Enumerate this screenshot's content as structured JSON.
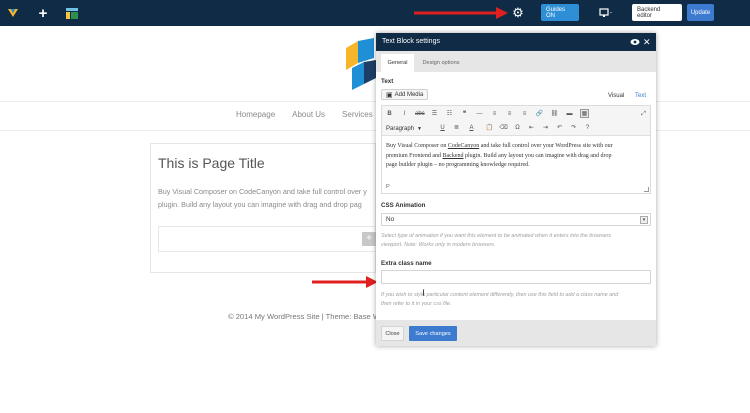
{
  "topbar": {
    "logo_icon": "composer-logo-icon",
    "add_icon": "plus-icon",
    "layout_icon": "layout-icon",
    "settings_icon": "gear-icon",
    "guides_label": "Guides ON",
    "device_icon": "monitor-icon",
    "backend_label": "Backend editor",
    "update_label": "Update"
  },
  "site": {
    "nav": [
      "Homepage",
      "About Us",
      "Services"
    ],
    "page_title": "This is Page Title",
    "page_text_lines": [
      "Buy Visual Composer on CodeCanyon and take full control over y",
      "plugin. Build any layout you can imagine with drag and drop pag"
    ],
    "add_icon": "plus-icon",
    "footer": "© 2014 My WordPress Site | Theme: Base W"
  },
  "panel": {
    "title": "Text Block settings",
    "visibility_icon": "eye-icon",
    "close_icon": "close-icon",
    "tabs": [
      "General",
      "Design options"
    ],
    "text_label": "Text",
    "add_media": "Add Media",
    "visual_tab": "Visual",
    "text_tab": "Text",
    "format_select": "Paragraph",
    "content_lines": [
      [
        "Buy Visual Composer on ",
        "CodeCanyon",
        " and take full control over your WordPress site with our"
      ],
      [
        "premium Frontend and ",
        "Backend",
        " plugin. Build any layout you can imagine with drag and drop"
      ],
      [
        "page builder plugin – no programming knowledge required.",
        "",
        ""
      ]
    ],
    "path_label": "P",
    "css_animation_label": "CSS Animation",
    "css_animation_value": "No",
    "css_animation_help": [
      "Select type of animation if you want this element to be animated when it enters into the browsers",
      "viewport. Note: Works only in modern browsers."
    ],
    "extra_class_label": "Extra class name",
    "extra_class_value": "",
    "extra_class_help": [
      "If you wish to style particular content element differently, then use this field to add a class name and",
      "then refer to it in your css file."
    ],
    "close_label": "Close",
    "save_label": "Save changes"
  },
  "colors": {
    "topbar": "#0f2b45",
    "guides_button": "#2e8fd6",
    "update_button": "#3d7bd1",
    "arrow": "#e02020",
    "logo_yellow": "#f7b52c",
    "logo_blue": "#1f8fd6",
    "logo_dark": "#1d3f66"
  }
}
